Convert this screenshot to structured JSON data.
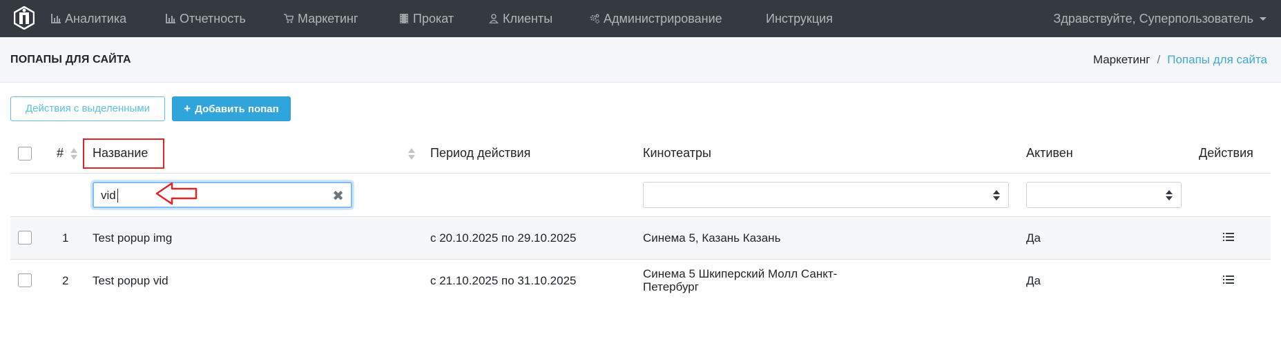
{
  "nav": {
    "items": [
      {
        "label": "Аналитика",
        "icon": "bar-chart-icon"
      },
      {
        "label": "Отчетность",
        "icon": "bar-chart-icon"
      },
      {
        "label": "Маркетинг",
        "icon": "cart-icon"
      },
      {
        "label": "Прокат",
        "icon": "film-icon"
      },
      {
        "label": "Клиенты",
        "icon": "user-icon"
      },
      {
        "label": "Администрирование",
        "icon": "gears-icon"
      },
      {
        "label": "Инструкция",
        "icon": ""
      }
    ],
    "user_greeting": "Здравствуйте, Суперпользователь"
  },
  "header": {
    "title": "ПОПАПЫ ДЛЯ САЙТА",
    "breadcrumb": [
      "Маркетинг",
      "Попапы для сайта"
    ],
    "breadcrumb_sep": "/"
  },
  "toolbar": {
    "bulk_actions_label": "Действия с выделенными",
    "add_label": "Добавить попап",
    "add_icon": "+"
  },
  "table": {
    "columns": [
      "#",
      "Название",
      "Период действия",
      "Кинотеатры",
      "Активен",
      "Действия"
    ],
    "filters": {
      "name_value": "vid",
      "clear_icon": "✖",
      "cinemas_selected": "",
      "active_selected": ""
    },
    "rows": [
      {
        "id": "1",
        "name": "Test popup img",
        "period": "с 20.10.2025 по 29.10.2025",
        "cinemas_line1": "Синема 5, Казань Казань",
        "cinemas_line2": "",
        "active": "Да"
      },
      {
        "id": "2",
        "name": "Test popup vid",
        "period": "с 21.10.2025 по 31.10.2025",
        "cinemas_line1": "Синема 5 Шкиперский Молл Санкт-",
        "cinemas_line2": "Петербург",
        "active": "Да"
      }
    ]
  },
  "colors": {
    "nav_bg": "#343a40",
    "accent": "#30a5dc",
    "outline": "#5bc0de",
    "annotation": "#e02424"
  }
}
